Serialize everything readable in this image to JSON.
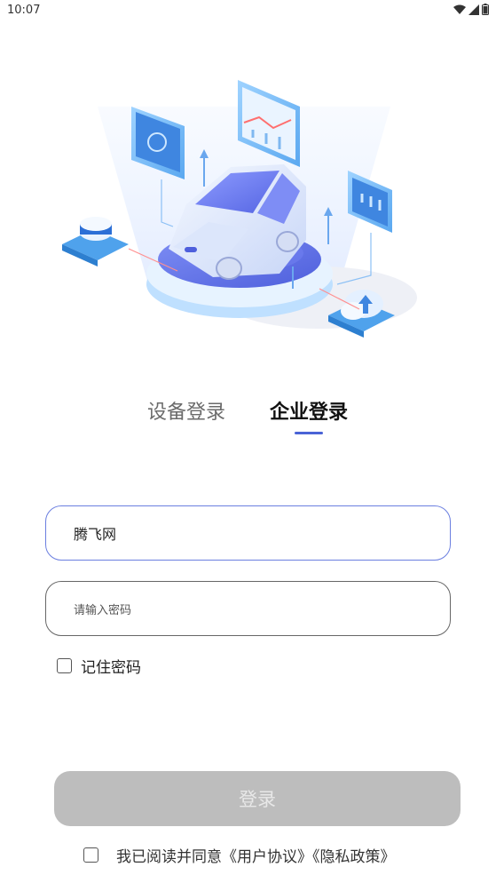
{
  "status_bar": {
    "time": "10:07",
    "icons": [
      "wifi-icon",
      "signal-icon",
      "battery-icon"
    ]
  },
  "tabs": {
    "device_login": "设备登录",
    "enterprise_login": "企业登录",
    "active": "enterprise_login"
  },
  "form": {
    "account_value": "腾飞网",
    "password_placeholder": "请输入密码",
    "remember_password": "记住密码",
    "remember_checked": false
  },
  "login_button": {
    "label": "登录",
    "enabled": false
  },
  "agreement": {
    "text": "我已阅读并同意《用户协议》《隐私政策》",
    "checked": false
  },
  "colors": {
    "accent": "#4a63d6",
    "button_disabled": "#bdbdbd",
    "field_active_border": "#6b7fe0"
  }
}
